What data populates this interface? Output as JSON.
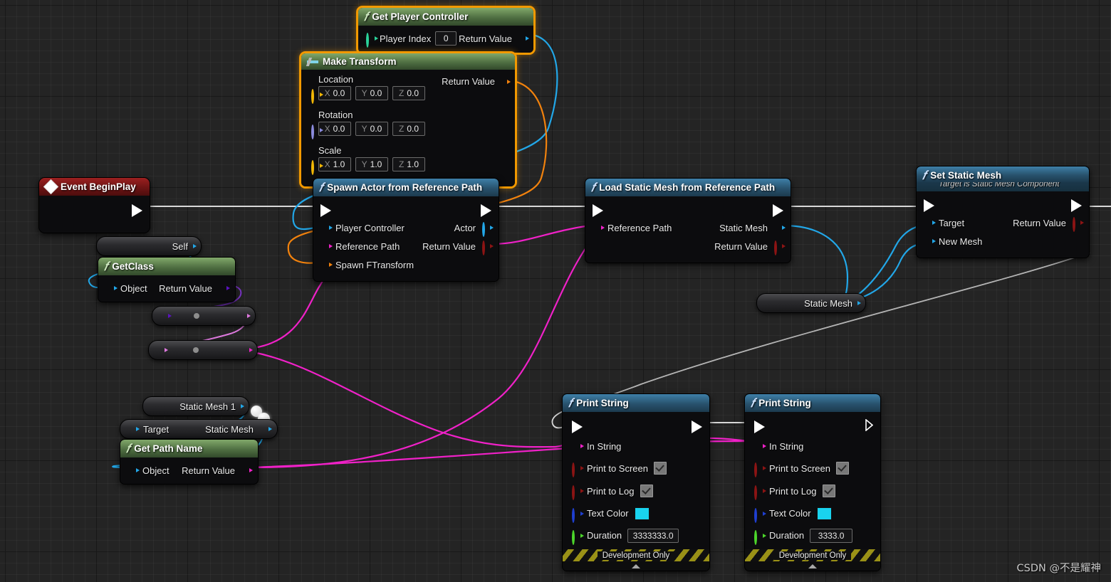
{
  "graph": {
    "watermark": "CSDN @不是耀神"
  },
  "nodes": {
    "get_player_controller": {
      "title": "Get Player Controller",
      "icon": "function-f-icon",
      "inputs": [
        {
          "label": "Player Index",
          "value": "0"
        }
      ],
      "outputs": [
        {
          "label": "Return Value"
        }
      ]
    },
    "make_transform": {
      "title": "Make Transform",
      "icon": "make-struct-icon",
      "groups": [
        {
          "label": "Location",
          "x": "0.0",
          "y": "0.0",
          "z": "0.0"
        },
        {
          "label": "Rotation",
          "x": "0.0",
          "y": "0.0",
          "z": "0.0"
        },
        {
          "label": "Scale",
          "x": "1.0",
          "y": "1.0",
          "z": "1.0"
        }
      ],
      "axes": {
        "x": "X",
        "y": "Y",
        "z": "Z"
      },
      "outputs": [
        {
          "label": "Return Value"
        }
      ]
    },
    "event_begin_play": {
      "title": "Event BeginPlay",
      "icon": "event-diamond-icon"
    },
    "spawn_actor": {
      "title": "Spawn Actor from Reference Path",
      "icon": "function-f-icon",
      "inputs": [
        {
          "label": "Player Controller"
        },
        {
          "label": "Reference Path"
        },
        {
          "label": "Spawn FTransform"
        }
      ],
      "outputs": [
        {
          "label": "Actor"
        },
        {
          "label": "Return Value"
        }
      ]
    },
    "load_static_mesh": {
      "title": "Load Static Mesh from Reference Path",
      "icon": "function-f-icon",
      "inputs": [
        {
          "label": "Reference Path"
        }
      ],
      "outputs": [
        {
          "label": "Static Mesh"
        },
        {
          "label": "Return Value"
        }
      ]
    },
    "set_static_mesh": {
      "title": "Set Static Mesh",
      "subtitle": "Target is Static Mesh Component",
      "icon": "function-f-icon",
      "inputs": [
        {
          "label": "Target"
        },
        {
          "label": "New Mesh"
        }
      ],
      "outputs": [
        {
          "label": "Return Value"
        }
      ]
    },
    "self_var": {
      "label": "Self"
    },
    "get_class": {
      "title": "GetClass",
      "icon": "function-f-icon",
      "inputs": [
        {
          "label": "Object"
        }
      ],
      "outputs": [
        {
          "label": "Return Value"
        }
      ]
    },
    "convert_node_1": {
      "label": ""
    },
    "convert_node_2": {
      "label": ""
    },
    "static_mesh_reroute": {
      "label": "Static Mesh"
    },
    "static_mesh_1_var": {
      "label": "Static Mesh 1"
    },
    "get_static_mesh": {
      "inputs": [
        {
          "label": "Target"
        }
      ],
      "outputs": [
        {
          "label": "Static Mesh"
        }
      ]
    },
    "get_path_name": {
      "title": "Get Path Name",
      "icon": "function-f-icon",
      "inputs": [
        {
          "label": "Object"
        }
      ],
      "outputs": [
        {
          "label": "Return Value"
        }
      ]
    },
    "print_string_1": {
      "title": "Print String",
      "icon": "function-f-icon",
      "inputs": [
        {
          "label": "In String"
        },
        {
          "label": "Print to Screen",
          "value": "checked"
        },
        {
          "label": "Print to Log",
          "value": "checked"
        },
        {
          "label": "Text Color",
          "value": "#19d3ef"
        },
        {
          "label": "Duration",
          "value": "3333333.0"
        }
      ],
      "footer": "Development Only"
    },
    "print_string_2": {
      "title": "Print String",
      "icon": "function-f-icon",
      "inputs": [
        {
          "label": "In String"
        },
        {
          "label": "Print to Screen",
          "value": "checked"
        },
        {
          "label": "Print to Log",
          "value": "checked"
        },
        {
          "label": "Text Color",
          "value": "#19d3ef"
        },
        {
          "label": "Duration",
          "value": "3333.0"
        }
      ],
      "footer": "Development Only"
    }
  },
  "colors": {
    "exec_wire": "#d8d8d8",
    "object_pin": "#22a7e8",
    "string_pin": "#f021c8",
    "struct_pin": "#f2820d",
    "class_pin": "#5b13c0",
    "name_pin": "#e07ae0",
    "bool_pin": "#8c1414",
    "float_pin": "#4cd62b",
    "linear_color_pin": "#1f3fd1",
    "rotator_pin": "#8b8bdd",
    "actor_pin": "#22a7e8",
    "return_red_pin": "#8c1414"
  }
}
